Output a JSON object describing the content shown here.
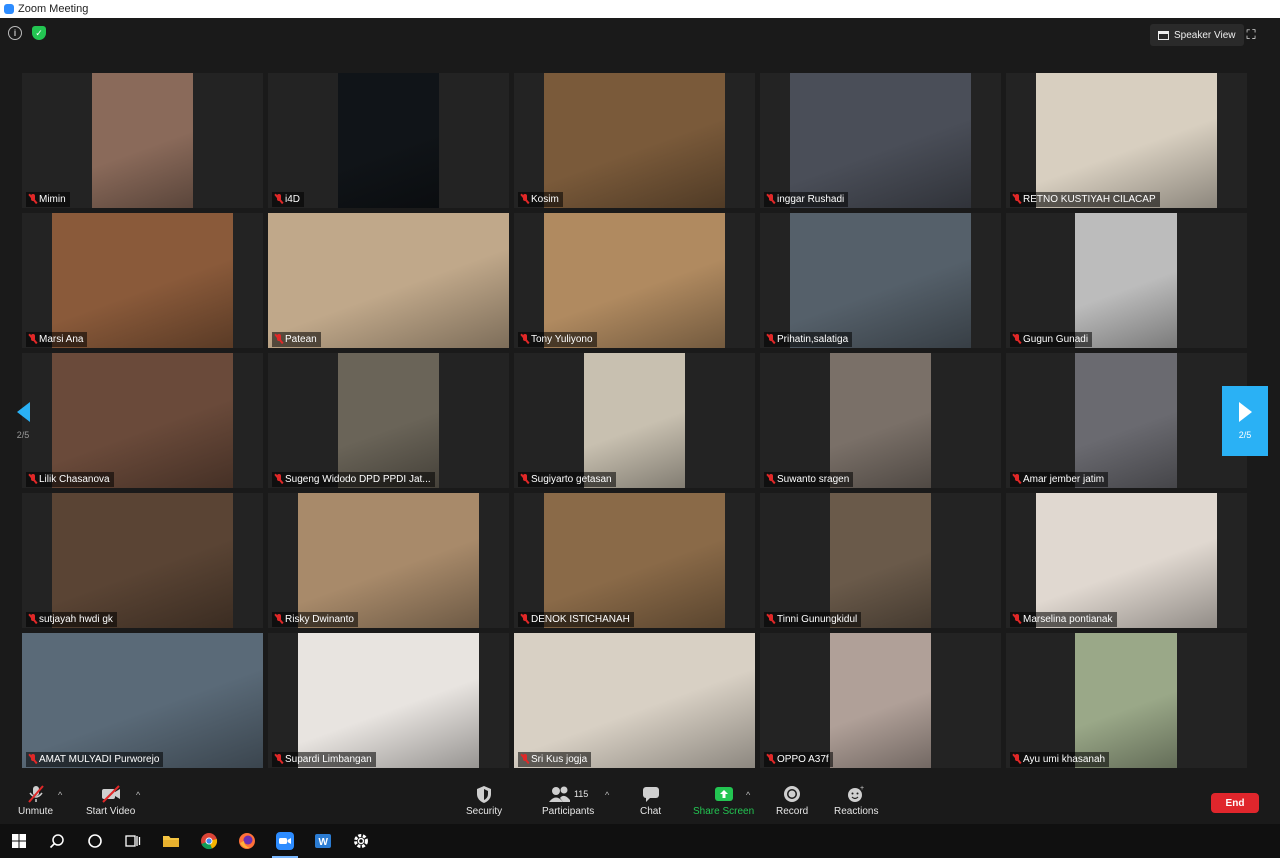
{
  "window": {
    "title": "Zoom Meeting"
  },
  "topbar": {
    "speaker_view_label": "Speaker View"
  },
  "pager": {
    "page_label": "2/5"
  },
  "participants": [
    {
      "name": "Mimin",
      "bg": "#8a6a5a"
    },
    {
      "name": "i4D",
      "bg": "#101418"
    },
    {
      "name": "Kosim",
      "bg": "#7a5a3a"
    },
    {
      "name": "inggar Rushadi",
      "bg": "#4a4e58"
    },
    {
      "name": "RETNO KUSTIYAH CILACAP",
      "bg": "#d8cfc0"
    },
    {
      "name": "Marsi Ana",
      "bg": "#8a5a3a"
    },
    {
      "name": "Patean",
      "bg": "#c0a88a"
    },
    {
      "name": "Tony Yuliyono",
      "bg": "#b08a60"
    },
    {
      "name": "Prihatin,salatiga",
      "bg": "#55606a"
    },
    {
      "name": "Gugun Gunadi",
      "bg": "#bcbcbc"
    },
    {
      "name": "Lilik Chasanova",
      "bg": "#6a4a3a"
    },
    {
      "name": "Sugeng Widodo DPD PPDI Jat...",
      "bg": "#6a6458"
    },
    {
      "name": "Sugiyarto getasan",
      "bg": "#c8c0b0"
    },
    {
      "name": "Suwanto sragen",
      "bg": "#7a7068"
    },
    {
      "name": "Amar jember jatim",
      "bg": "#6a6a70"
    },
    {
      "name": "sutjayah hwdi gk",
      "bg": "#5a4434"
    },
    {
      "name": "Risky Dwinanto",
      "bg": "#a88a6a"
    },
    {
      "name": "DENOK ISTICHANAH",
      "bg": "#8a6a48"
    },
    {
      "name": "Tinni Gunungkidul",
      "bg": "#6a5a4a"
    },
    {
      "name": "Marselina pontianak",
      "bg": "#e0d8d0"
    },
    {
      "name": "AMAT MULYADI Purworejo",
      "bg": "#5a6a78"
    },
    {
      "name": "Supardi Limbangan",
      "bg": "#e8e4e0"
    },
    {
      "name": "Sri Kus jogja",
      "bg": "#d8d0c4"
    },
    {
      "name": "OPPO A37f",
      "bg": "#b0a098"
    },
    {
      "name": "Ayu umi khasanah",
      "bg": "#9aa888"
    }
  ],
  "toolbar": {
    "unmute": "Unmute",
    "start_video": "Start Video",
    "security": "Security",
    "participants": "Participants",
    "participants_count": "115",
    "chat": "Chat",
    "share_screen": "Share Screen",
    "record": "Record",
    "reactions": "Reactions",
    "end": "End"
  },
  "colors": {
    "accent": "#2ab1f5",
    "share": "#23c552",
    "end": "#e0262c",
    "muted": "#e02828"
  }
}
